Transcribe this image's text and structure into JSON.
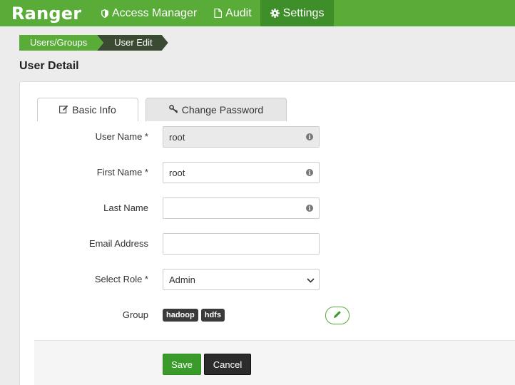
{
  "nav": {
    "brand": "Ranger",
    "items": [
      {
        "label": "Access Manager",
        "icon": "shield-icon"
      },
      {
        "label": "Audit",
        "icon": "file-icon"
      },
      {
        "label": "Settings",
        "icon": "gear-icon"
      }
    ]
  },
  "breadcrumb": [
    "Users/Groups",
    "User Edit"
  ],
  "page_title": "User Detail",
  "tabs": [
    {
      "label": "Basic Info",
      "icon": "edit-icon"
    },
    {
      "label": "Change Password",
      "icon": "key-icon"
    }
  ],
  "form": {
    "user_name": {
      "label": "User Name *",
      "value": "root"
    },
    "first_name": {
      "label": "First Name *",
      "value": "root"
    },
    "last_name": {
      "label": "Last Name",
      "value": ""
    },
    "email": {
      "label": "Email Address",
      "value": ""
    },
    "role": {
      "label": "Select Role *",
      "value": "Admin"
    },
    "group": {
      "label": "Group",
      "values": [
        "hadoop",
        "hdfs"
      ]
    }
  },
  "buttons": {
    "save": "Save",
    "cancel": "Cancel"
  },
  "colors": {
    "brand_green": "#58ac37",
    "active_nav": "#3e8e2a",
    "dark_button": "#2b2b2b"
  }
}
